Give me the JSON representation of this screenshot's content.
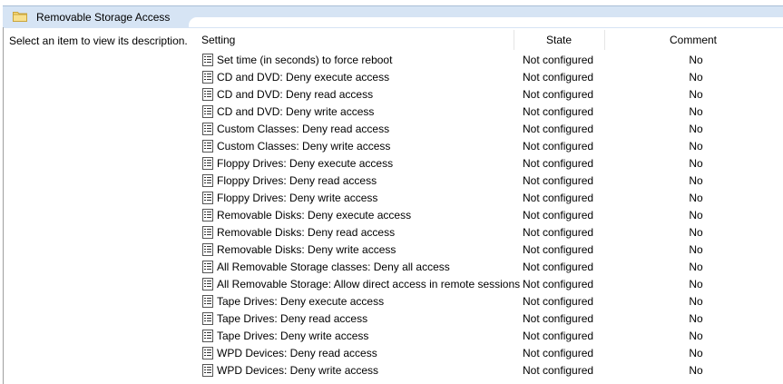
{
  "header": {
    "title": "Removable Storage Access",
    "folder_icon": "folder-icon"
  },
  "description": {
    "text": "Select an item to view its description."
  },
  "columns": {
    "setting": "Setting",
    "state": "State",
    "comment": "Comment"
  },
  "rows": [
    {
      "name": "Set time (in seconds) to force reboot",
      "state": "Not configured",
      "comment": "No"
    },
    {
      "name": "CD and DVD: Deny execute access",
      "state": "Not configured",
      "comment": "No"
    },
    {
      "name": "CD and DVD: Deny read access",
      "state": "Not configured",
      "comment": "No"
    },
    {
      "name": "CD and DVD: Deny write access",
      "state": "Not configured",
      "comment": "No"
    },
    {
      "name": "Custom Classes: Deny read access",
      "state": "Not configured",
      "comment": "No"
    },
    {
      "name": "Custom Classes: Deny write access",
      "state": "Not configured",
      "comment": "No"
    },
    {
      "name": "Floppy Drives: Deny execute access",
      "state": "Not configured",
      "comment": "No"
    },
    {
      "name": "Floppy Drives: Deny read access",
      "state": "Not configured",
      "comment": "No"
    },
    {
      "name": "Floppy Drives: Deny write access",
      "state": "Not configured",
      "comment": "No"
    },
    {
      "name": "Removable Disks: Deny execute access",
      "state": "Not configured",
      "comment": "No"
    },
    {
      "name": "Removable Disks: Deny read access",
      "state": "Not configured",
      "comment": "No"
    },
    {
      "name": "Removable Disks: Deny write access",
      "state": "Not configured",
      "comment": "No"
    },
    {
      "name": "All Removable Storage classes: Deny all access",
      "state": "Not configured",
      "comment": "No"
    },
    {
      "name": "All Removable Storage: Allow direct access in remote sessions",
      "state": "Not configured",
      "comment": "No"
    },
    {
      "name": "Tape Drives: Deny execute access",
      "state": "Not configured",
      "comment": "No"
    },
    {
      "name": "Tape Drives: Deny read access",
      "state": "Not configured",
      "comment": "No"
    },
    {
      "name": "Tape Drives: Deny write access",
      "state": "Not configured",
      "comment": "No"
    },
    {
      "name": "WPD Devices: Deny read access",
      "state": "Not configured",
      "comment": "No"
    },
    {
      "name": "WPD Devices: Deny write access",
      "state": "Not configured",
      "comment": "No"
    }
  ],
  "row_icon": "policy-setting-icon"
}
